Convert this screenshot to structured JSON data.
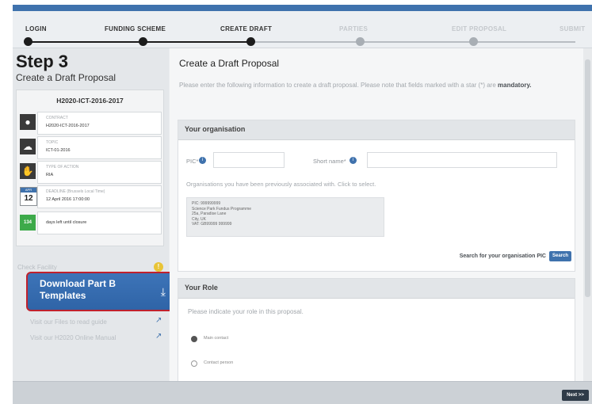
{
  "steps": [
    {
      "label": "LOGIN",
      "state": "done"
    },
    {
      "label": "FUNDING SCHEME",
      "state": "done"
    },
    {
      "label": "CREATE DRAFT",
      "state": "current"
    },
    {
      "label": "PARTIES",
      "state": "pending"
    },
    {
      "label": "EDIT PROPOSAL",
      "state": "pending"
    },
    {
      "label": "SUBMIT",
      "state": "pending"
    }
  ],
  "sidebar": {
    "step_title": "Step 3",
    "step_subtitle": "Create a Draft Proposal",
    "call_id": "H2020-ICT-2016-2017",
    "info": [
      {
        "label": "CONTRACT",
        "value": "H2020-ICT-2016-2017",
        "icon": "user-icon"
      },
      {
        "label": "TOPIC",
        "value": "ICT-01-2016",
        "icon": "cloud-icon"
      },
      {
        "label": "TYPE OF ACTION",
        "value": "RIA",
        "icon": "hand-icon"
      }
    ],
    "deadline": {
      "label": "DEADLINE (Brussels Local Time)",
      "value": "12 April 2016 17:00:00",
      "day": "12",
      "month": "APR"
    },
    "days_left": {
      "badge": "134",
      "text": "days left until closure"
    },
    "check_facility": "Check Facility",
    "download_button": "Download Part B Templates",
    "links": [
      "Visit our Files to read guide",
      "Visit our H2020 Online Manual"
    ]
  },
  "main": {
    "title": "Create a Draft Proposal",
    "intro_text": "Please enter the following information to create a draft proposal. Please note that fields marked with a star (*) are ",
    "intro_bold": "mandatory.",
    "org_panel": {
      "title": "Your organisation",
      "pic_label": "PIC*",
      "short_name_label": "Short name*",
      "pic_value": "",
      "short_name_value": "",
      "associated_text": "Organisations you have been previously associated with. Click to select.",
      "org_lines": [
        "PIC: 999999999",
        "Science Park Fundus Programme",
        "25a, Paradise Lane",
        "City, UK",
        "VAT: GB99999 999999"
      ],
      "search_label": "Search for your organisation PIC",
      "search_button": "Search"
    },
    "role_panel": {
      "title": "Your Role",
      "text": "Please indicate your role in this proposal.",
      "options": [
        {
          "label": "Main contact",
          "checked": true
        },
        {
          "label": "Contact person",
          "checked": false
        }
      ]
    }
  },
  "footer": {
    "next_button": "Next >>"
  },
  "colors": {
    "accent": "#3f72ad",
    "download_border": "#c0212c",
    "days_green": "#3daa4a"
  }
}
